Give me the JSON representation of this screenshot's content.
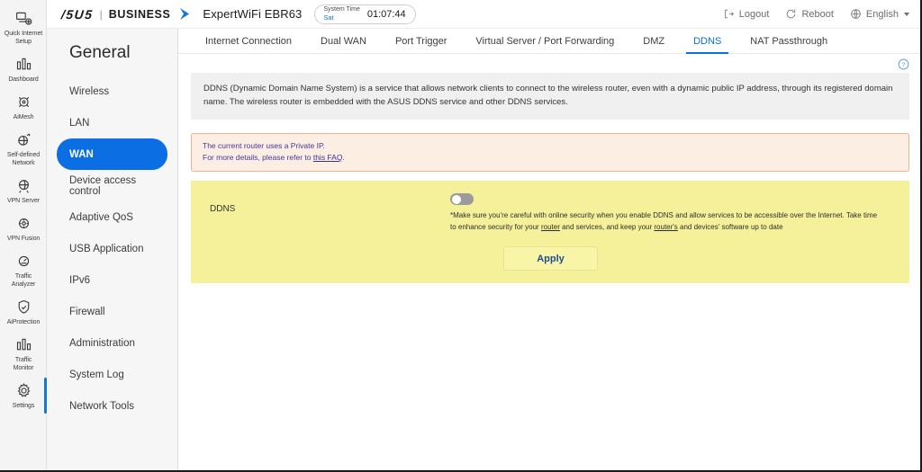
{
  "rail": {
    "items": [
      {
        "label": "Quick Internet\nSetup",
        "icon": "quick-setup-icon",
        "active": false
      },
      {
        "label": "Dashboard",
        "icon": "dashboard-icon",
        "active": false
      },
      {
        "label": "AiMesh",
        "icon": "aimesh-icon",
        "active": false
      },
      {
        "label": "Self-defined\nNetwork",
        "icon": "self-defined-network-icon",
        "active": false
      },
      {
        "label": "VPN Server",
        "icon": "vpn-server-icon",
        "active": false
      },
      {
        "label": "VPN Fusion",
        "icon": "vpn-fusion-icon",
        "active": false
      },
      {
        "label": "Traffic\nAnalyzer",
        "icon": "traffic-analyzer-icon",
        "active": false
      },
      {
        "label": "AiProtection",
        "icon": "aiprotection-icon",
        "active": false
      },
      {
        "label": "Traffic\nMonitor",
        "icon": "traffic-monitor-icon",
        "active": false
      },
      {
        "label": "Settings",
        "icon": "gear-icon",
        "active": true
      }
    ]
  },
  "header": {
    "logo_asus": "/5U5",
    "logo_divider": "|",
    "logo_business": "BUSINESS",
    "model": "ExpertWiFi EBR63",
    "system_time_title": "System Time",
    "system_time_day": "Sat",
    "system_time_clock": "01:07:44",
    "logout_label": "Logout",
    "reboot_label": "Reboot",
    "language_label": "English",
    "accent_color": "#0b6fe3"
  },
  "general_menu": {
    "title": "General",
    "items": [
      {
        "label": "Wireless",
        "active": false
      },
      {
        "label": "LAN",
        "active": false
      },
      {
        "label": "WAN",
        "active": true
      },
      {
        "label": "Device access control",
        "active": false
      },
      {
        "label": "Adaptive QoS",
        "active": false
      },
      {
        "label": "USB Application",
        "active": false
      },
      {
        "label": "IPv6",
        "active": false
      },
      {
        "label": "Firewall",
        "active": false
      },
      {
        "label": "Administration",
        "active": false
      },
      {
        "label": "System Log",
        "active": false
      },
      {
        "label": "Network Tools",
        "active": false
      }
    ]
  },
  "tabs": [
    {
      "label": "Internet Connection",
      "active": false
    },
    {
      "label": "Dual WAN",
      "active": false
    },
    {
      "label": "Port Trigger",
      "active": false
    },
    {
      "label": "Virtual Server / Port Forwarding",
      "active": false
    },
    {
      "label": "DMZ",
      "active": false
    },
    {
      "label": "DDNS",
      "active": true
    },
    {
      "label": "NAT Passthrough",
      "active": false
    }
  ],
  "content": {
    "help_icon": "help-circle-icon",
    "description": "DDNS (Dynamic Domain Name System) is a service that allows network clients to connect to the wireless router, even with a dynamic public IP address, through its registered domain name. The wireless router is embedded with the ASUS DDNS service and other DDNS services.",
    "warning": {
      "line1": "The current router uses a Private IP.",
      "line2_prefix": "For more details, please refer to ",
      "line2_link": "this FAQ",
      "line2_suffix": "."
    },
    "ddns": {
      "label": "DDNS",
      "toggle_state": "off",
      "note_part1": "*Make sure you're careful with online security when you enable DDNS and allow services to be accessible over the Internet. Take time to enhance security for your ",
      "note_link1": "router",
      "note_part2": " and services, and keep your ",
      "note_link2": "router's",
      "note_part3": " and devices' software up to date",
      "apply_label": "Apply"
    }
  }
}
